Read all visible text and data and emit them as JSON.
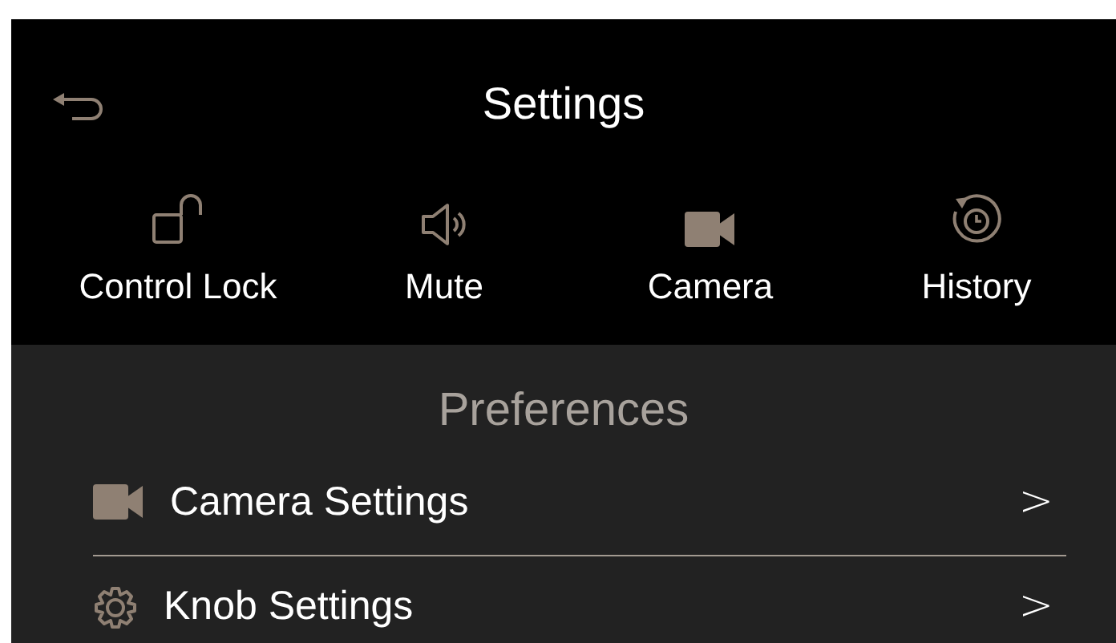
{
  "header": {
    "title": "Settings"
  },
  "quick_actions": [
    {
      "label": "Control Lock"
    },
    {
      "label": "Mute"
    },
    {
      "label": "Camera"
    },
    {
      "label": "History"
    }
  ],
  "section": {
    "title": "Preferences"
  },
  "items": [
    {
      "label": "Camera Settings",
      "chevron": ">"
    },
    {
      "label": "Knob Settings",
      "chevron": ">"
    }
  ]
}
